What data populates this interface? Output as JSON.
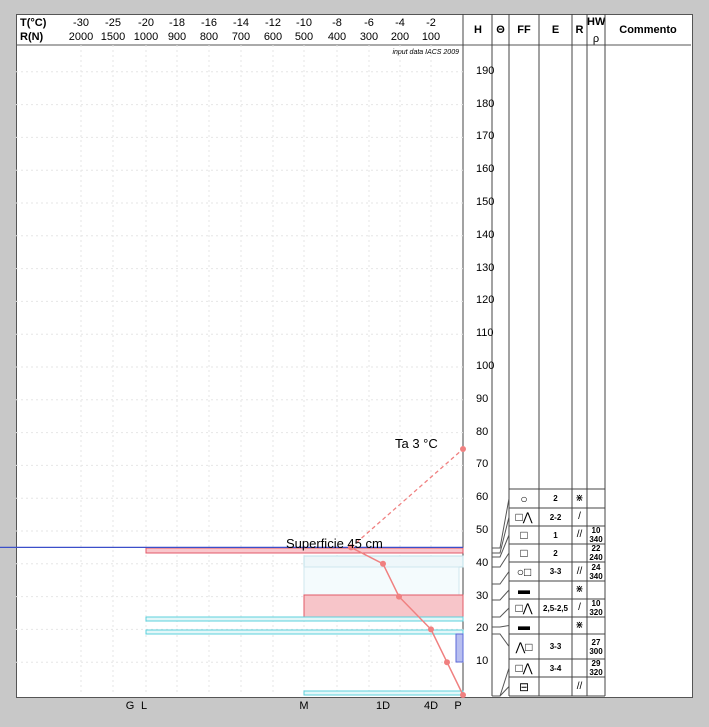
{
  "chart_data": {
    "type": "line",
    "header_labels": {
      "t": "T(°C)",
      "r": "R(N)"
    },
    "temperature_ticks": [
      "-30",
      "-25",
      "-20",
      "-18",
      "-16",
      "-14",
      "-12",
      "-10",
      "-8",
      "-6",
      "-4",
      "-2"
    ],
    "resistance_ticks": [
      "2000",
      "1500",
      "1000",
      "900",
      "800",
      "700",
      "600",
      "500",
      "400",
      "300",
      "200",
      "100"
    ],
    "source_note": "input data IACS 2009",
    "column_headers": {
      "h": "H",
      "theta": "Θ",
      "ff": "FF",
      "e": "E",
      "r": "R",
      "hw": "HW",
      "rho": "ρ",
      "commento": "Commento"
    },
    "height_axis": {
      "min": 0,
      "max": 195,
      "ticks": [
        10,
        20,
        30,
        40,
        50,
        60,
        70,
        80,
        90,
        100,
        110,
        120,
        130,
        140,
        150,
        160,
        170,
        180,
        190
      ]
    },
    "bottom_labels": [
      "G",
      "L",
      "M",
      "1D",
      "4D",
      "P"
    ],
    "temperature_profile": [
      {
        "h": 0,
        "t": 0
      },
      {
        "h": 10,
        "t": -1
      },
      {
        "h": 20,
        "t": -2
      },
      {
        "h": 30,
        "t": -4
      },
      {
        "h": 40,
        "t": -5
      },
      {
        "h": 45,
        "t": -7
      }
    ],
    "air_temperature": {
      "h": 75,
      "t": 0,
      "label": "Ta  3 °C"
    },
    "surface_label": "Superficie  45 cm",
    "layers": [
      {
        "ff": "○",
        "e": "2",
        "r": "⋇",
        "hw": "",
        "rho": ""
      },
      {
        "ff": "□⋀",
        "e": "2-2",
        "r": "/",
        "hw": "",
        "rho": ""
      },
      {
        "ff": "□",
        "e": "1",
        "r": "//",
        "hw": "10",
        "rho": "340"
      },
      {
        "ff": "□",
        "e": "2",
        "r": "",
        "hw": "22",
        "rho": "240"
      },
      {
        "ff": "○□",
        "e": "3-3",
        "r": "//",
        "hw": "24",
        "rho": "340"
      },
      {
        "ff": "▬",
        "e": "",
        "r": "⋇",
        "hw": "",
        "rho": ""
      },
      {
        "ff": "□⋀",
        "e": "2,5-2,5",
        "r": "/",
        "hw": "10",
        "rho": "320"
      },
      {
        "ff": "▬",
        "e": "",
        "r": "⋇",
        "hw": "",
        "rho": ""
      },
      {
        "ff": "⋀□",
        "e": "3-3",
        "r": "",
        "hw": "27",
        "rho": "300"
      },
      {
        "ff": "□⋀",
        "e": "3-4",
        "r": "",
        "hw": "29",
        "rho": "320"
      },
      {
        "ff": "⊟",
        "e": "",
        "r": "//",
        "hw": "",
        "rho": ""
      }
    ]
  }
}
